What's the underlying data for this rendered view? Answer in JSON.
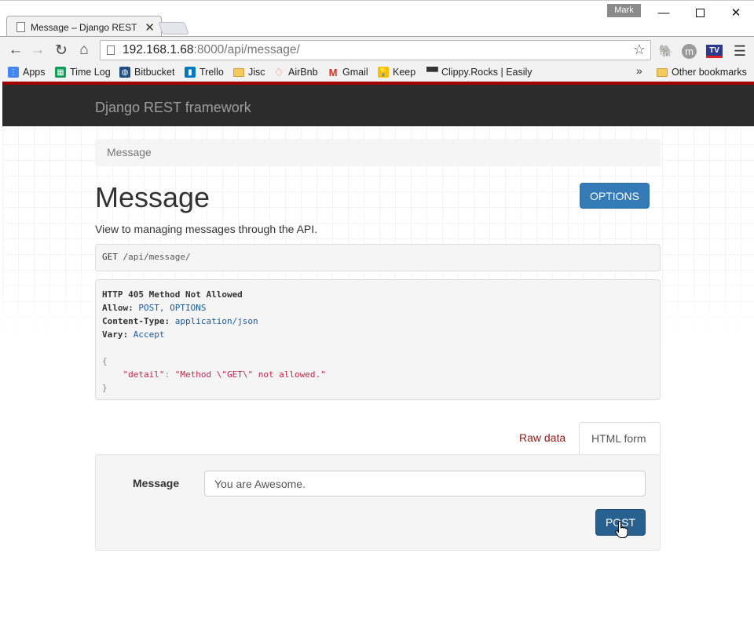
{
  "browser": {
    "tab_title": "Message – Django REST fr",
    "profile": "Mark",
    "url_host": "192.168.1.68",
    "url_rest": ":8000/api/message/",
    "bookmarks": [
      {
        "label": "Apps",
        "icon": "apps-grid-icon",
        "color": "#4285f4"
      },
      {
        "label": "Time Log",
        "icon": "sheets-icon",
        "color": "#0f9d58"
      },
      {
        "label": "Bitbucket",
        "icon": "bitbucket-icon",
        "color": "#205081"
      },
      {
        "label": "Trello",
        "icon": "trello-icon",
        "color": "#0079bf"
      },
      {
        "label": "Jisc",
        "icon": "folder-icon",
        "color": "#f4c95d"
      },
      {
        "label": "AirBnb",
        "icon": "airbnb-icon",
        "color": "#ff5a5f"
      },
      {
        "label": "Gmail",
        "icon": "gmail-icon",
        "color": "#d93025"
      },
      {
        "label": "Keep",
        "icon": "keep-icon",
        "color": "#fbbc04"
      },
      {
        "label": "Clippy.Rocks | Easily s",
        "icon": "clippy-icon",
        "color": "#333333"
      }
    ],
    "more_bookmarks": "»",
    "other_bookmarks": "Other bookmarks"
  },
  "navbar": {
    "brand": "Django REST framework",
    "accent_color": "#a30000"
  },
  "breadcrumb": "Message",
  "page": {
    "title": "Message",
    "options_label": "OPTIONS",
    "description": "View to managing messages through the API."
  },
  "request": {
    "method": "GET",
    "path": "/api/message/"
  },
  "response": {
    "status_line": "HTTP 405 Method Not Allowed",
    "headers": [
      {
        "name": "Allow:",
        "value": "POST, OPTIONS"
      },
      {
        "name": "Content-Type:",
        "value": "application/json"
      },
      {
        "name": "Vary:",
        "value": "Accept"
      }
    ],
    "body_open": "{",
    "body_key": "\"detail\"",
    "body_colon": ":",
    "body_value": "\"Method \\\"GET\\\" not allowed.\"",
    "body_close": "}"
  },
  "tabs": {
    "raw": "Raw data",
    "form": "HTML form"
  },
  "form": {
    "label": "Message",
    "value": "You are Awesome.",
    "submit": "POST"
  }
}
